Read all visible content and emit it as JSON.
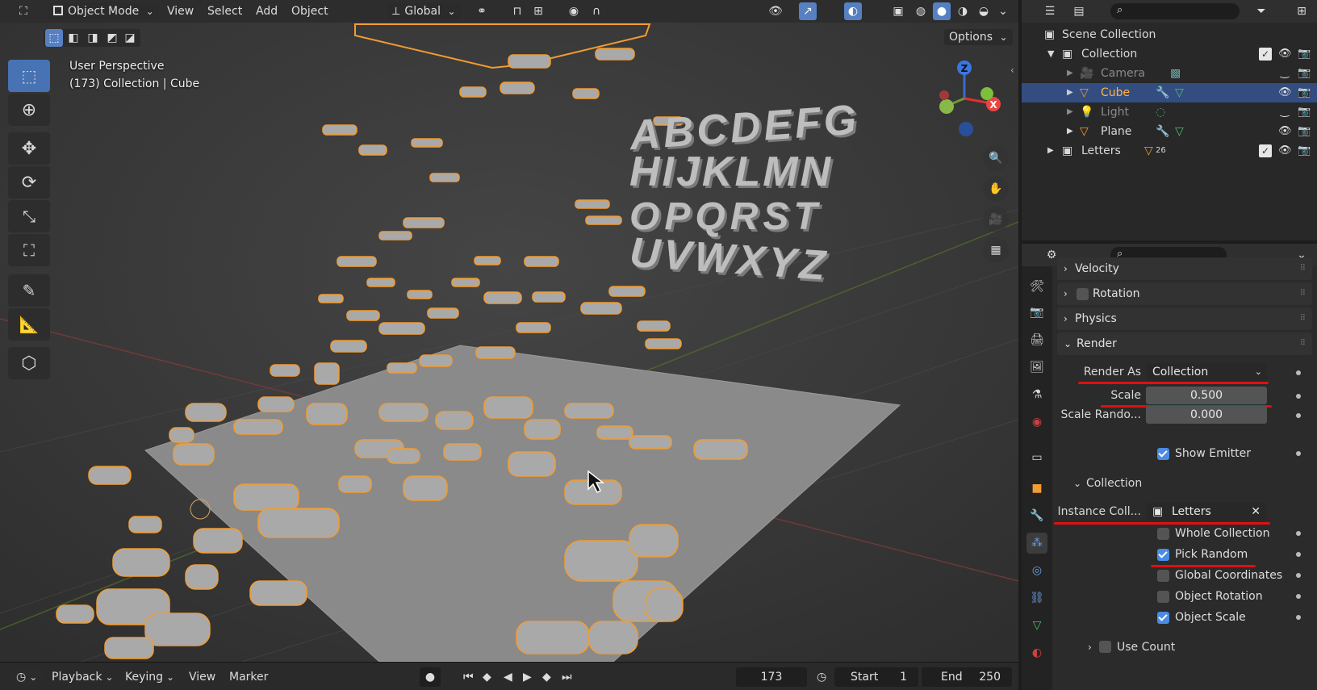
{
  "viewport": {
    "header": {
      "mode": "Object Mode",
      "menus": [
        "View",
        "Select",
        "Add",
        "Object"
      ],
      "transform_orientation": "Global",
      "options": "Options"
    },
    "perspective_label": "User Perspective",
    "context_label": "(173) Collection | Cube",
    "gizmo_axes": {
      "z": "Z",
      "x": "X"
    },
    "scene_letters": [
      "ABCDEFG",
      "HIJKLMN",
      "OPQRST",
      "UVWXYZ"
    ]
  },
  "timeline": {
    "menus": [
      "Playback",
      "Keying",
      "View",
      "Marker"
    ],
    "current_frame": "173",
    "start_label": "Start",
    "start_value": "1",
    "end_label": "End",
    "end_value": "250"
  },
  "outliner": {
    "root": "Scene Collection",
    "items": [
      {
        "label": "Collection",
        "icon": "collection-icon"
      },
      {
        "label": "Camera",
        "icon": "camera-object-icon"
      },
      {
        "label": "Cube",
        "icon": "mesh-object-icon"
      },
      {
        "label": "Light",
        "icon": "light-object-icon"
      },
      {
        "label": "Plane",
        "icon": "mesh-object-icon"
      },
      {
        "label": "Letters",
        "icon": "collection-icon",
        "badge": "26"
      }
    ]
  },
  "properties": {
    "panels": {
      "velocity": "Velocity",
      "rotation": "Rotation",
      "physics": "Physics",
      "render": "Render",
      "collection": "Collection",
      "use_count": "Use Count"
    },
    "render_as_label": "Render As",
    "render_as_value": "Collection",
    "scale_label": "Scale",
    "scale_value": "0.500",
    "scale_random_label": "Scale Rando...",
    "scale_random_value": "0.000",
    "show_emitter": "Show Emitter",
    "instance_collection_label": "Instance Coll...",
    "instance_collection_value": "Letters",
    "checkboxes": [
      {
        "label": "Whole Collection",
        "checked": false
      },
      {
        "label": "Pick Random",
        "checked": true
      },
      {
        "label": "Global Coordinates",
        "checked": false
      },
      {
        "label": "Object Rotation",
        "checked": false
      },
      {
        "label": "Object Scale",
        "checked": true
      }
    ]
  },
  "colors": {
    "accent_blue": "#4772b3",
    "selection_orange": "#f39c31",
    "annotation_red": "#e01010"
  }
}
